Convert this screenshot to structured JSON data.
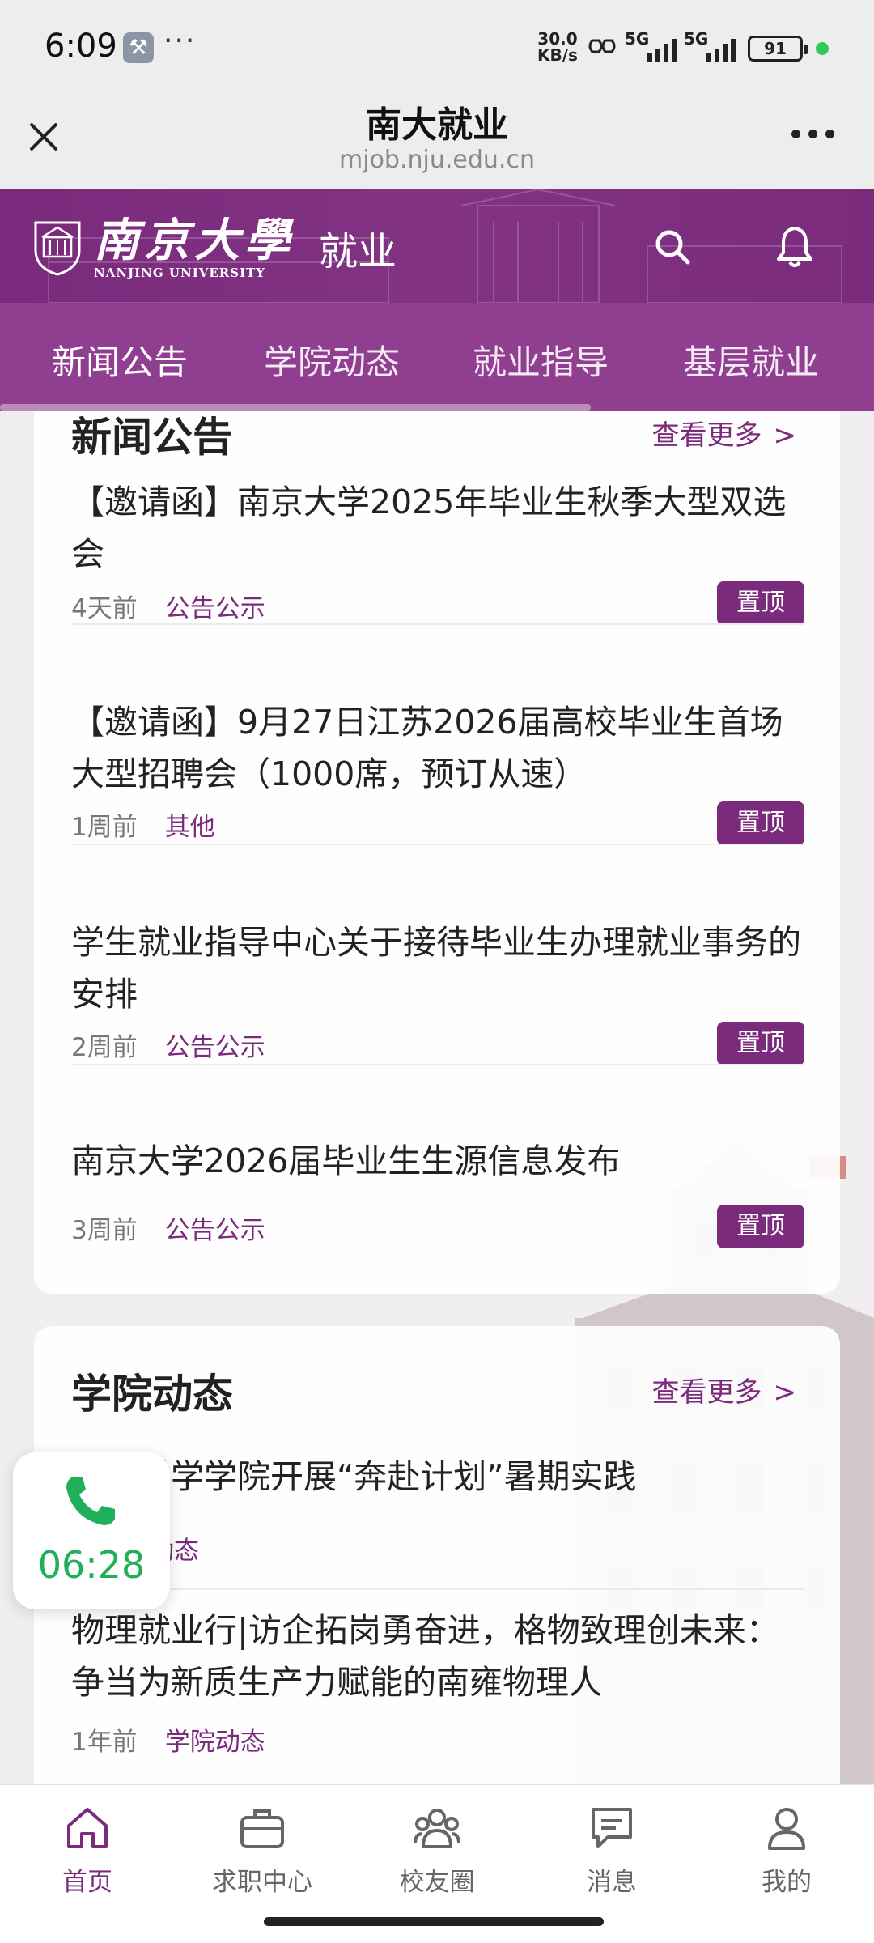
{
  "status_bar": {
    "time": "6:09",
    "net_speed_value": "30.0",
    "net_speed_unit": "KB/s",
    "sim1": "5G",
    "sim2": "5G",
    "battery": "91"
  },
  "browser": {
    "title": "南大就业",
    "url": "mjob.nju.edu.cn"
  },
  "header": {
    "logo_cn": "南京大學",
    "logo_en": "NANJING UNIVERSITY",
    "logo_sub": "就业"
  },
  "category_tabs": [
    {
      "label": "新闻公告"
    },
    {
      "label": "学院动态"
    },
    {
      "label": "就业指导"
    },
    {
      "label": "基层就业"
    }
  ],
  "news_section": {
    "title": "新闻公告",
    "more": "查看更多",
    "items": [
      {
        "title": "【邀请函】南京大学2025年毕业生秋季大型双选会",
        "time": "4天前",
        "tag": "公告公示",
        "badge": "置顶"
      },
      {
        "title": "【邀请函】9月27日江苏2026届高校毕业生首场大型招聘会（1000席，预订从速）",
        "time": "1周前",
        "tag": "其他",
        "badge": "置顶"
      },
      {
        "title": "学生就业指导中心关于接待毕业生办理就业事务的安排",
        "time": "2周前",
        "tag": "公告公示",
        "badge": "置顶"
      },
      {
        "title": "南京大学2026届毕业生生源信息发布",
        "time": "3周前",
        "tag": "公告公示",
        "badge": "置顶"
      }
    ]
  },
  "college_section": {
    "title": "学院动态",
    "more": "查看更多",
    "items": [
      {
        "title": "空间科学学院开展“奔赴计划”暑期实践",
        "tag": "学院动态"
      },
      {
        "title": "物理就业行|访企拓岗勇奋进，格物致理创未来：争当为新质生产力赋能的南雍物理人",
        "time": "1年前",
        "tag": "学院动态"
      }
    ]
  },
  "call_widget": {
    "time": "06:28",
    "color": "#21b05a"
  },
  "bottom_nav": [
    {
      "label": "首页",
      "icon": "home-icon"
    },
    {
      "label": "求职中心",
      "icon": "briefcase-icon"
    },
    {
      "label": "校友圈",
      "icon": "people-icon"
    },
    {
      "label": "消息",
      "icon": "chat-icon"
    },
    {
      "label": "我的",
      "icon": "person-icon"
    }
  ],
  "colors": {
    "brand": "#7b2b7c",
    "tabs_bg": "#903f90"
  }
}
